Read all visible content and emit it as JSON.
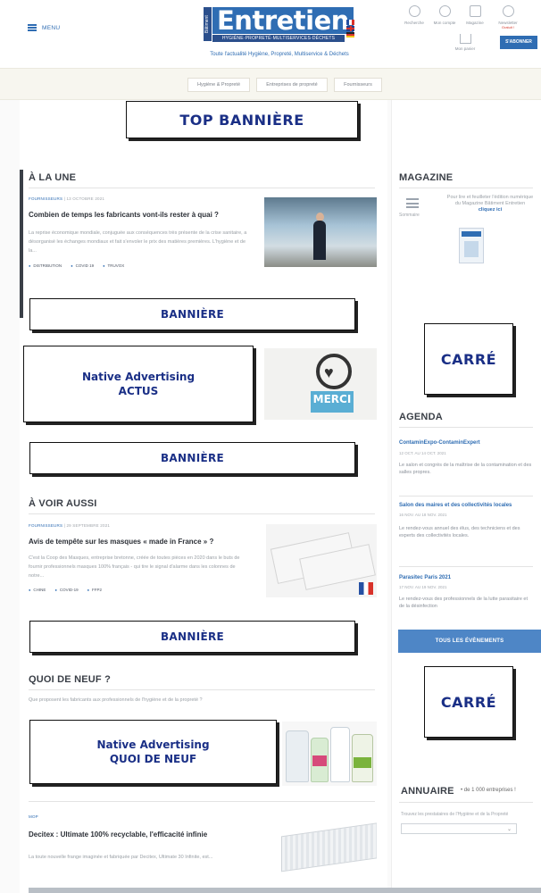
{
  "header": {
    "menu_label": "MENU",
    "logo_word": "Entretien",
    "logo_side": "Bâtiment",
    "logo_sub": "HYGIÈNE·PROPRETÉ·MULTISERVICES·DÉCHETS",
    "tagline": "Toute l'actualité Hygiène, Propreté, Multiservice & Déchets",
    "tools": [
      {
        "label": "Recherche",
        "icon": "search-icon"
      },
      {
        "label": "Mon compte",
        "icon": "user-icon"
      },
      {
        "label": "Magazine",
        "icon": "magazine-icon"
      },
      {
        "label": "Newsletter",
        "icon": "newsletter-icon",
        "sub": "Gratuit !"
      }
    ],
    "cart_label": "Mon panier",
    "subscribe_label": "S'ABONNER"
  },
  "nav": {
    "tabs": [
      "Hygiène & Propreté",
      "Entreprises de propreté",
      "Fournisseurs"
    ]
  },
  "placeholders": {
    "top_banner": "TOP BANNIÈRE",
    "banner": "BANNIÈRE",
    "square": "CARRÉ",
    "native_actus_l1": "Native Advertising",
    "native_actus_l2": "ACTUS",
    "native_quoi_l1": "Native Advertising",
    "native_quoi_l2": "QUOI DE NEUF"
  },
  "a_la_une": {
    "title": "À LA UNE",
    "category": "FOURNISSEURS",
    "date": "13 OCTOBRE 2021",
    "headline": "Combien de temps les fabricants vont-ils rester à quai ?",
    "text": "La reprise économique mondiale, conjuguée aux conséquences très présente de la crise sanitaire, a désorganisé les échanges mondiaux et fait s'envoler le prix des matières premières. L'hygiène et de la...",
    "tags": [
      "DISTRIBUTION",
      "COVID 19",
      "TRUVOX"
    ]
  },
  "a_voir_aussi": {
    "title": "À VOIR AUSSI",
    "category": "FOURNISSEURS",
    "date": "29 SEPTEMBRE 2021",
    "headline": "Avis de tempête sur les masques « made in France » ?",
    "text": "C'est la Coop des Masques, entreprise bretonne, créée de toutes pièces en 2020 dans le buts de fournir professionnels masques 100% français - qui tire le signal d'alarme dans les colonnes de notre...",
    "tags": [
      "CHINE",
      "COVID-19",
      "FFP2"
    ]
  },
  "quoi_de_neuf": {
    "title": "QUOI DE NEUF ?",
    "intro": "Que proposent les fabricants aux professionnels de l'hygiène et de la propreté ?",
    "category": "MOP",
    "headline": "Decitex : Ultimate 100% recyclable, l'efficacité infinie",
    "text": "La toute nouvelle frange imaginée et fabriquée par Decitex, Ultimate 30 Infinite, est..."
  },
  "magazine": {
    "title": "MAGAZINE",
    "summary_label": "Sommaire",
    "text": "Pour lire et feuilleter l'édition numérique du Magazine Bâtiment Entretien",
    "link": "cliquez ici"
  },
  "agenda": {
    "title": "AGENDA",
    "events": [
      {
        "title": "ContaminExpo-ContaminExpert",
        "date": "12 OCT. AU 14 OCT. 2021",
        "desc": "Le salon et congrès de la maîtrise de la contamination et des salles propres."
      },
      {
        "title": "Salon des maires et des collectivités locales",
        "date": "16 NOV. AU 18 NOV. 2021",
        "desc": "Le rendez-vous annuel des élus, des techniciens et des experts des collectivités locales."
      },
      {
        "title": "Parasitec Paris 2021",
        "date": "17 NOV. AU 19 NOV. 2021",
        "desc": "Le rendez-vous des professionnels de la lutte parasitaire et de la désinfection"
      }
    ],
    "button": "TOUS LES ÉVÈNEMENTS"
  },
  "annuaire": {
    "title": "ANNUAIRE",
    "count": "• de 1 000 entreprises !",
    "desc": "Trouvez les prestataires de l'Hygiène et de la Propreté"
  },
  "colors": {
    "accent": "#2f6db3",
    "placeholder_text": "#1a2f86",
    "agenda_button": "#4e86c6"
  }
}
